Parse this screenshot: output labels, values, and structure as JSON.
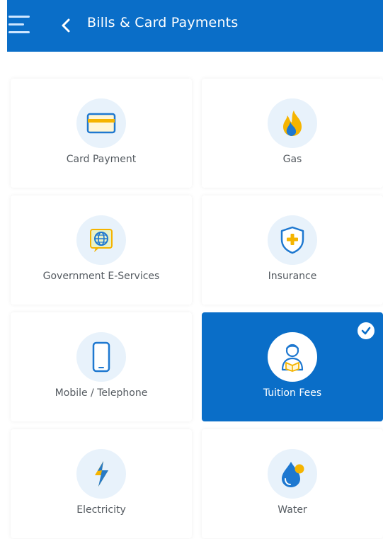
{
  "header": {
    "title": "Bills & Card Payments",
    "background_color": "#0a6ec8",
    "menu_icon": "hamburger-menu-icon",
    "back_icon": "chevron-left-icon"
  },
  "tiles": [
    {
      "label": "Card Payment",
      "icon": "credit-card-icon",
      "selected": false
    },
    {
      "label": "Gas",
      "icon": "flame-icon",
      "selected": false
    },
    {
      "label": "Government E-Services",
      "icon": "globe-icon",
      "selected": false
    },
    {
      "label": "Insurance",
      "icon": "shield-plus-icon",
      "selected": false
    },
    {
      "label": "Mobile / Telephone",
      "icon": "mobile-phone-icon",
      "selected": false
    },
    {
      "label": "Tuition Fees",
      "icon": "student-icon",
      "selected": true
    },
    {
      "label": "Electricity",
      "icon": "lightning-bolt-icon",
      "selected": false
    },
    {
      "label": "Water",
      "icon": "water-drop-icon",
      "selected": false
    }
  ],
  "colors": {
    "accent": "#0a6ec8",
    "icon_blue": "#1e78d0",
    "icon_yellow": "#f5b400",
    "icon_bg": "#e8f2fb",
    "label_text": "#555b61"
  }
}
